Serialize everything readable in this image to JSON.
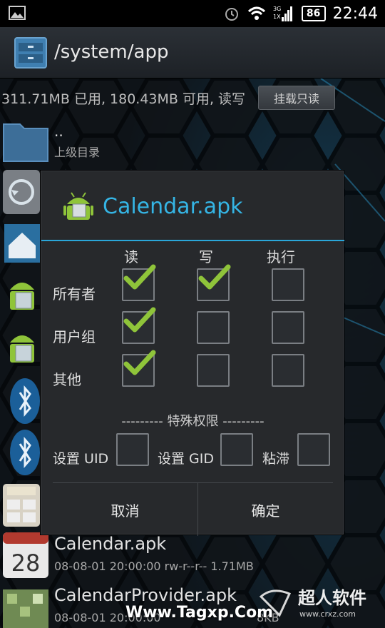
{
  "status_bar": {
    "time": "22:44",
    "battery": "86",
    "network": "3G"
  },
  "title_bar": {
    "path": "/system/app"
  },
  "storage": {
    "info": "311.71MB 已用, 180.43MB 可用, 读写",
    "mount_button": "挂载只读"
  },
  "file_list": {
    "parent": {
      "name": "..",
      "label": "上级目录"
    },
    "items": [
      {
        "name": "Calendar.apk",
        "meta": "08-08-01 20:00:00  rw-r--r--  1.71MB",
        "icon": "calendar-28-icon",
        "date_num": "28"
      },
      {
        "name": "CalendarProvider.apk",
        "meta": "08-08-01 20:00:00",
        "meta_tail": "8KB",
        "icon": "provider-icon"
      }
    ]
  },
  "dialog": {
    "title": "Calendar.apk",
    "columns": [
      "读",
      "写",
      "执行"
    ],
    "rows": [
      {
        "label": "所有者",
        "checked": [
          true,
          true,
          false
        ]
      },
      {
        "label": "用户组",
        "checked": [
          true,
          false,
          false
        ]
      },
      {
        "label": "其他",
        "checked": [
          true,
          false,
          false
        ]
      }
    ],
    "special_header": "--------- 特殊权限 ---------",
    "special": [
      {
        "label": "设置 UID",
        "checked": false
      },
      {
        "label": "设置 GID",
        "checked": false
      },
      {
        "label": "粘滞",
        "checked": false
      }
    ],
    "cancel": "取消",
    "ok": "确定"
  },
  "watermark": {
    "site": "Www.Tagxp.Com",
    "logo_text": "超人软件",
    "logo_url": "www.crxz.com"
  },
  "colors": {
    "accent": "#35b5e5",
    "check": "#8fc43a",
    "dialog_bg": "#27292c"
  }
}
